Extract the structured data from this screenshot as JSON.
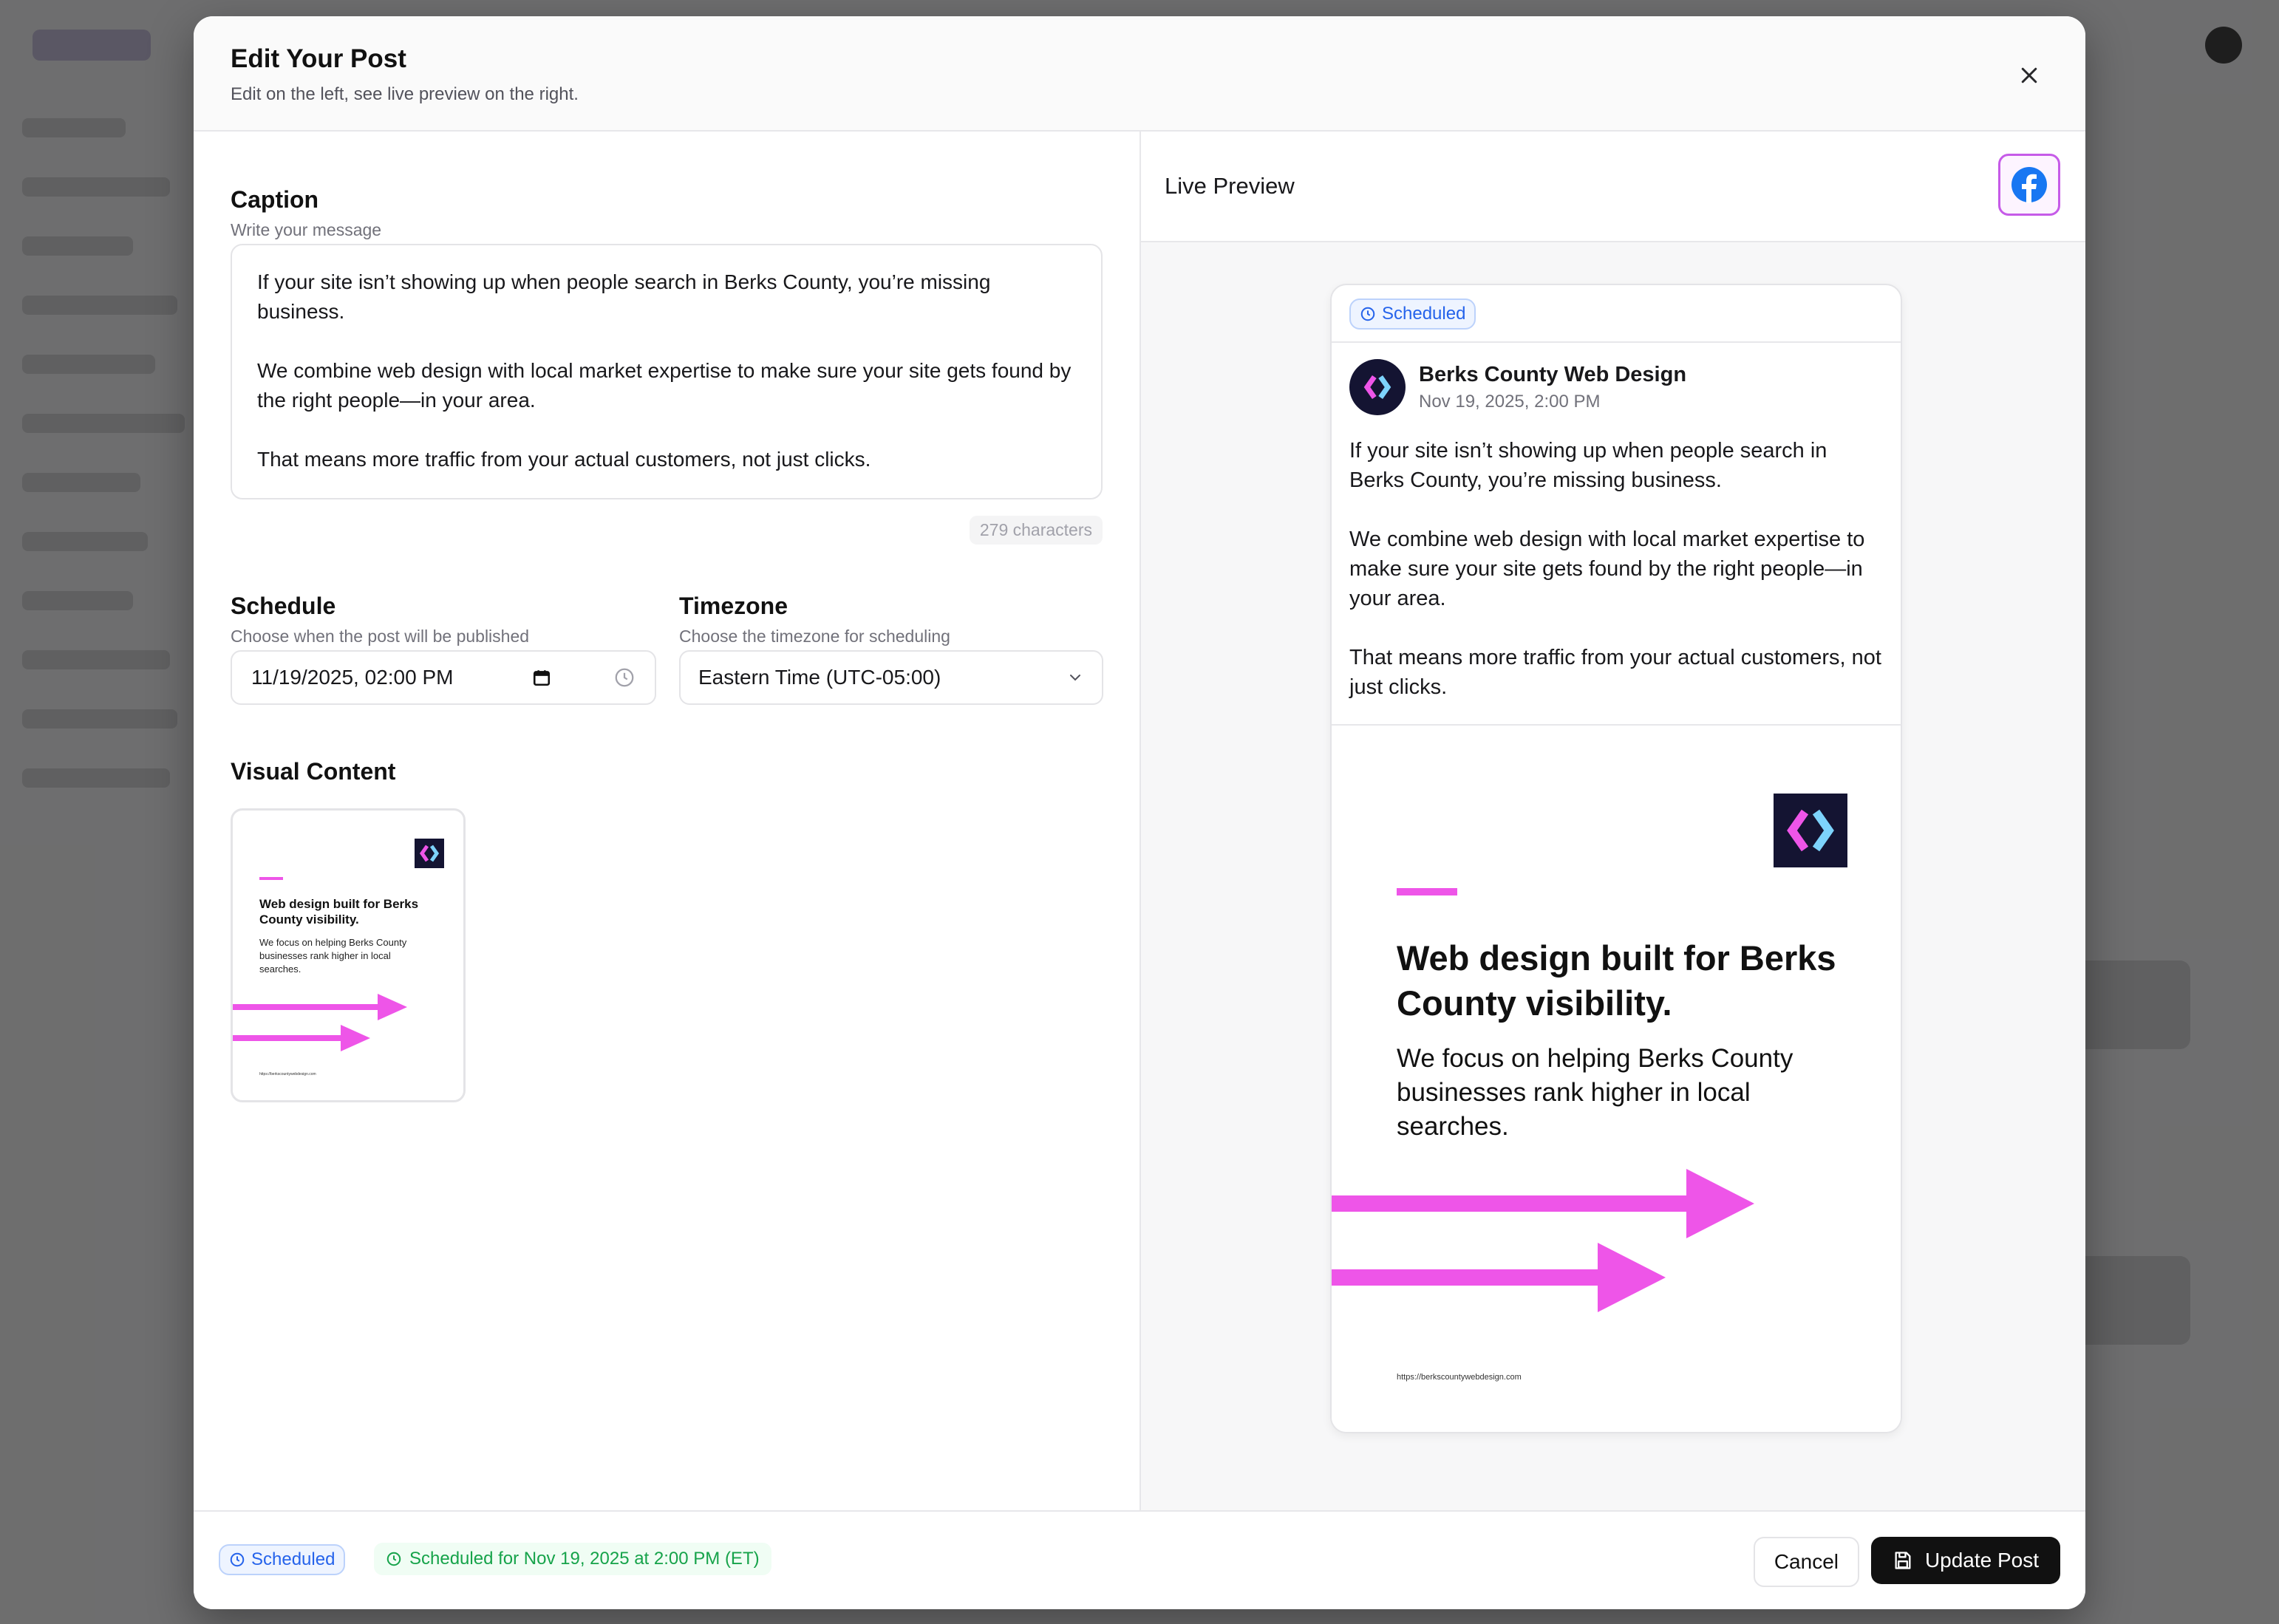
{
  "modal": {
    "title": "Edit Your Post",
    "subtitle": "Edit on the left, see live preview on the right."
  },
  "caption": {
    "title": "Caption",
    "subtitle": "Write your message",
    "paragraphs": [
      "If your site isn’t showing up when people search in Berks County, you’re missing business.",
      "We combine web design with local market expertise to make sure your site gets found by the right people—in your area.",
      "That means more traffic from your actual customers, not just clicks."
    ],
    "char_count": "279 characters"
  },
  "schedule": {
    "title": "Schedule",
    "subtitle": "Choose when the post will be published",
    "value": "11/19/2025, 02:00 PM"
  },
  "timezone": {
    "title": "Timezone",
    "subtitle": "Choose the timezone for scheduling",
    "value": "Eastern Time (UTC-05:00)"
  },
  "visual": {
    "title": "Visual Content",
    "headline": "Web design built for Berks County visibility.",
    "body": "We focus on helping Berks County businesses rank higher in local searches.",
    "url": "https://berkscountywebdesign.com"
  },
  "preview": {
    "label": "Live Preview",
    "platform_icon": "facebook-icon",
    "status_badge": "Scheduled",
    "author_name": "Berks County Web Design",
    "author_date": "Nov 19, 2025, 2:00 PM",
    "paragraphs": [
      "If your site isn’t showing up when people search in Berks County, you’re missing business.",
      "We combine web design with local market expertise to make sure your site gets found by the right people—in your area.",
      "That means more traffic from your actual customers, not just clicks."
    ]
  },
  "footer": {
    "status_badge": "Scheduled",
    "schedule_note": "Scheduled for Nov 19, 2025 at 2:00 PM (ET)",
    "cancel_label": "Cancel",
    "update_label": "Update Post"
  },
  "colors": {
    "accent_magenta": "#ee55e8",
    "brand_navy": "#141432",
    "badge_blue": "#2563eb",
    "success_green": "#16a34a",
    "facebook_blue": "#1877f2"
  }
}
